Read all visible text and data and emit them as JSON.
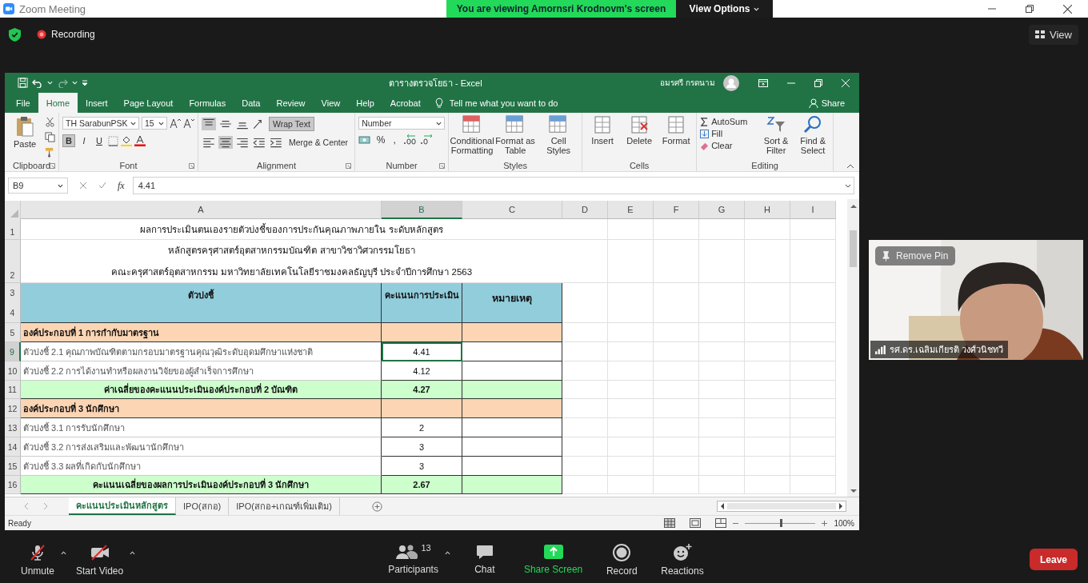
{
  "zoom_title_bar": {
    "title": "Zoom Meeting",
    "banner": "You are viewing Amornsri Krodnovm's screen",
    "view_options": "View Options"
  },
  "meeting_bar": {
    "recording": "Recording",
    "view": "View"
  },
  "excel": {
    "title": "ตารางตรวจโยธา - Excel",
    "user": "อมรศรี กรดนาม",
    "ribbon_tabs": [
      {
        "label": "File",
        "selected": false
      },
      {
        "label": "Home",
        "selected": true
      },
      {
        "label": "Insert",
        "selected": false
      },
      {
        "label": "Page Layout",
        "selected": false
      },
      {
        "label": "Formulas",
        "selected": false
      },
      {
        "label": "Data",
        "selected": false
      },
      {
        "label": "Review",
        "selected": false
      },
      {
        "label": "View",
        "selected": false
      },
      {
        "label": "Help",
        "selected": false
      },
      {
        "label": "Acrobat",
        "selected": false
      }
    ],
    "tell_me": "Tell me what you want to do",
    "share": "Share",
    "ribbon": {
      "paste": "Paste",
      "clipboard_label": "Clipboard",
      "font_name": "TH SarabunPSK",
      "font_size": "15",
      "format_buttons": [
        {
          "label": "B",
          "on": true
        },
        {
          "label": "I",
          "on": false
        },
        {
          "label": "U",
          "on": false
        }
      ],
      "font_label": "Font",
      "wrap_text": {
        "label": "Wrap Text",
        "on": true
      },
      "merge_center": "Merge & Center",
      "alignment_label": "Alignment",
      "number_format": "Number",
      "percent": "%",
      "comma": ",",
      "number_label": "Number",
      "styles": [
        "Conditional Formatting",
        "Format as Table",
        "Cell Styles"
      ],
      "styles_label": "Styles",
      "cells": [
        "Insert",
        "Delete",
        "Format"
      ],
      "cells_label": "Cells",
      "autosum": "AutoSum",
      "fill": "Fill",
      "clear": "Clear",
      "sort_filter": "Sort & Filter",
      "find_select": "Find & Select",
      "editing_label": "Editing"
    },
    "formula_bar": {
      "name_box": "B9",
      "fx": "fx",
      "value": "4.41"
    },
    "columns": [
      {
        "label": "A",
        "selected": false
      },
      {
        "label": "B",
        "selected": true
      },
      {
        "label": "C",
        "selected": false
      },
      {
        "label": "D",
        "selected": false
      },
      {
        "label": "E",
        "selected": false
      },
      {
        "label": "F",
        "selected": false
      },
      {
        "label": "G",
        "selected": false
      },
      {
        "label": "H",
        "selected": false
      },
      {
        "label": "I",
        "selected": false
      }
    ],
    "rows": [
      {
        "numbers": [
          "1"
        ],
        "kind": "title",
        "selected": false,
        "lines": [
          "ผลการประเมินตนเองรายตัวบ่งชี้ของการประกันคุณภาพภายใน ระดับหลักสูตร"
        ]
      },
      {
        "numbers": [
          "2"
        ],
        "kind": "title",
        "selected": false,
        "lines": [
          "หลักสูตรครุศาสตร์อุตสาหกรรมบัณฑิต สาขาวิชาวิศวกรรมโยธา",
          "คณะครุศาสตร์อุตสาหกรรม มหาวิทยาลัยเทคโนโลยีราชมงคลธัญบุรี ประจำปีการศึกษา 2563"
        ]
      },
      {
        "numbers": [
          "3",
          "4"
        ],
        "kind": "header",
        "selected": false,
        "a": "ตัวบ่งชี้",
        "b": "คะแนนการประเมิน",
        "c": "หมายเหตุ"
      },
      {
        "numbers": [
          "5"
        ],
        "kind": "section",
        "selected": false,
        "a": "องค์ประกอบที่ 1 การกำกับมาตรฐาน"
      },
      {
        "numbers": [
          "9"
        ],
        "kind": "item",
        "selected": true,
        "a": "ตัวบ่งชี้ 2.1 คุณภาพบัณฑิตตามกรอบมาตรฐานคุณวุฒิระดับอุดมศึกษาแห่งชาติ",
        "b": "4.41"
      },
      {
        "numbers": [
          "10"
        ],
        "kind": "item",
        "selected": false,
        "a": "ตัวบ่งชี้ 2.2 การได้งานทำหรือผลงานวิจัยของผู้สำเร็จการศึกษา",
        "b": "4.12"
      },
      {
        "numbers": [
          "11"
        ],
        "kind": "average",
        "selected": false,
        "a": "ค่าเฉลี่ยของคะแนนประเมินองค์ประกอบที่ 2 บัณฑิต",
        "b": "4.27"
      },
      {
        "numbers": [
          "12"
        ],
        "kind": "section",
        "selected": false,
        "a": "องค์ประกอบที่ 3 นักศึกษา"
      },
      {
        "numbers": [
          "13"
        ],
        "kind": "item",
        "selected": false,
        "a": "ตัวบ่งชี้ 3.1 การรับนักศึกษา",
        "b": "2"
      },
      {
        "numbers": [
          "14"
        ],
        "kind": "item",
        "selected": false,
        "a": "ตัวบ่งชี้ 3.2 การส่งเสริมและพัฒนานักศึกษา",
        "b": "3"
      },
      {
        "numbers": [
          "15"
        ],
        "kind": "item",
        "selected": false,
        "a": "ตัวบ่งชี้ 3.3 ผลที่เกิดกับนักศึกษา",
        "b": "3"
      },
      {
        "numbers": [
          "16"
        ],
        "kind": "average",
        "selected": false,
        "a": "คะแนนเฉลี่ยของผลการประเมินองค์ประกอบที่ 3 นักศึกษา",
        "b": "2.67"
      }
    ],
    "sheet_tabs": [
      {
        "label": "คะแนนประเมินหลักสูตร",
        "selected": true
      },
      {
        "label": "IPO(สกอ)",
        "selected": false
      },
      {
        "label": "IPO(สกอ+เกณฑ์เพิ่มเติม)",
        "selected": false
      }
    ],
    "status": "Ready",
    "zoom_slider": {
      "level": 0.5
    },
    "zoom": "100%"
  },
  "video": {
    "remove_pin": "Remove Pin",
    "name": "รศ.ดร.เฉลิมเกียรติ วงศ์วนิชทวี"
  },
  "toolbar": {
    "items": [
      {
        "kind": "mic",
        "label": "Unmute"
      },
      {
        "kind": "video",
        "label": "Start Video"
      },
      {
        "kind": "participants",
        "label": "Participants"
      },
      {
        "kind": "chat",
        "label": "Chat"
      },
      {
        "kind": "share",
        "label": "Share Screen"
      },
      {
        "kind": "record",
        "label": "Record"
      },
      {
        "kind": "reactions",
        "label": "Reactions"
      }
    ],
    "participants_count": "13",
    "leave": "Leave"
  }
}
